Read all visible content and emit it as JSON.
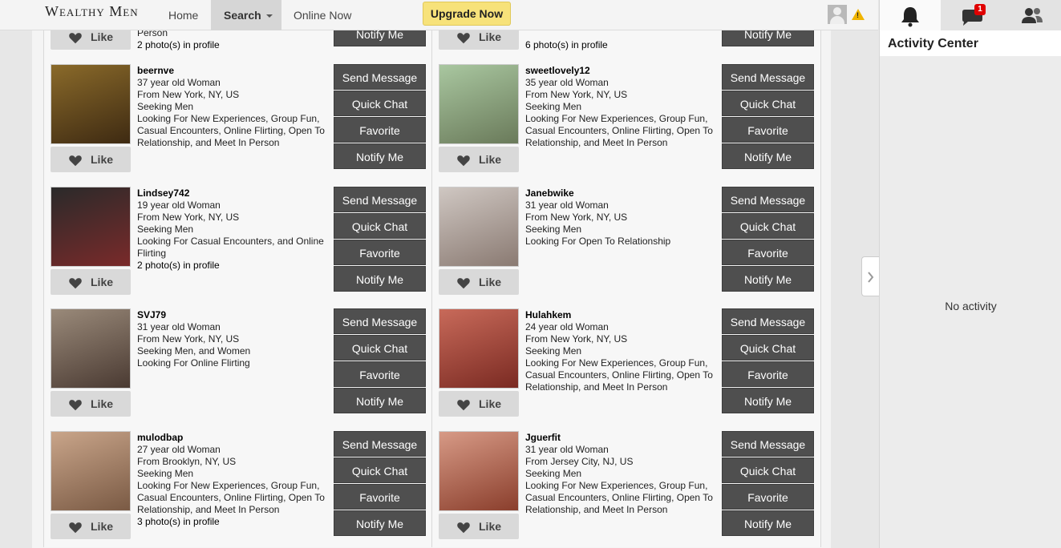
{
  "header": {
    "logo": "Wealthy Men",
    "nav": {
      "home": "Home",
      "search": "Search",
      "online": "Online Now"
    },
    "upgrade": "Upgrade Now"
  },
  "buttons": {
    "send": "Send Message",
    "chat": "Quick Chat",
    "favorite": "Favorite",
    "notify": "Notify Me",
    "like": "Like"
  },
  "rows": [
    {
      "left": {
        "line": "Person",
        "photos": "2 photo(s) in profile"
      },
      "right": {
        "photos": "6 photo(s) in profile"
      }
    },
    {
      "left": {
        "name": "beernve",
        "age": "37 year old Woman",
        "from": "From New York, NY, US",
        "seeking": "Seeking Men",
        "looking": "Looking For New Experiences, Group Fun, Casual Encounters, Online Flirting, Open To Relationship, and Meet In Person",
        "photos": ""
      },
      "right": {
        "name": "sweetlovely12",
        "age": "35 year old Woman",
        "from": "From New York, NY, US",
        "seeking": "Seeking Men",
        "looking": "Looking For New Experiences, Group Fun, Casual Encounters, Online Flirting, Open To Relationship, and Meet In Person",
        "photos": ""
      }
    },
    {
      "left": {
        "name": "Lindsey742",
        "age": "19 year old Woman",
        "from": "From New York, NY, US",
        "seeking": "Seeking Men",
        "looking": "Looking For Casual Encounters, and Online Flirting",
        "photos": "2 photo(s) in profile"
      },
      "right": {
        "name": "Janebwike",
        "age": "31 year old Woman",
        "from": "From New York, NY, US",
        "seeking": "Seeking Men",
        "looking": "Looking For Open To Relationship",
        "photos": ""
      }
    },
    {
      "left": {
        "name": "SVJ79",
        "age": "31 year old Woman",
        "from": "From New York, NY, US",
        "seeking": "Seeking Men, and Women",
        "looking": "Looking For Online Flirting",
        "photos": ""
      },
      "right": {
        "name": "Hulahkem",
        "age": "24 year old Woman",
        "from": "From New York, NY, US",
        "seeking": "Seeking Men",
        "looking": "Looking For New Experiences, Group Fun, Casual Encounters, Online Flirting, Open To Relationship, and Meet In Person",
        "photos": ""
      }
    },
    {
      "left": {
        "name": "mulodbap",
        "age": "27 year old Woman",
        "from": "From Brooklyn, NY, US",
        "seeking": "Seeking Men",
        "looking": "Looking For New Experiences, Group Fun, Casual Encounters, Online Flirting, Open To Relationship, and Meet In Person",
        "photos": "3 photo(s) in profile"
      },
      "right": {
        "name": "Jguerfit",
        "age": "31 year old Woman",
        "from": "From Jersey City, NJ, US",
        "seeking": "Seeking Men",
        "looking": "Looking For New Experiences, Group Fun, Casual Encounters, Online Flirting, Open To Relationship, and Meet In Person",
        "photos": ""
      }
    }
  ],
  "sidebar": {
    "title": "Activity Center",
    "empty": "No activity",
    "messages_badge": "1"
  },
  "colors": {
    "button": "#4f4f4f",
    "upgrade": "#f7e27a",
    "badge": "#e00000"
  }
}
